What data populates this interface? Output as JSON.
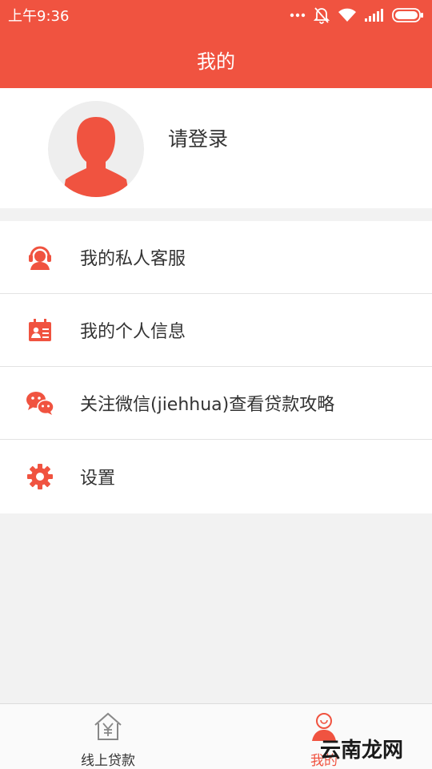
{
  "status_bar": {
    "time": "上午9:36"
  },
  "header": {
    "title": "我的"
  },
  "profile": {
    "login_prompt": "请登录"
  },
  "menu": {
    "items": [
      {
        "label": "我的私人客服",
        "icon": "headset-agent-icon"
      },
      {
        "label": "我的个人信息",
        "icon": "id-card-icon"
      },
      {
        "label": "关注微信(jiehhua)查看贷款攻略",
        "icon": "wechat-icon"
      },
      {
        "label": "设置",
        "icon": "gear-icon"
      }
    ]
  },
  "bottom_nav": {
    "tabs": [
      {
        "label": "线上贷款",
        "icon": "house-yen-icon",
        "active": false
      },
      {
        "label": "我的",
        "icon": "user-icon",
        "active": true
      }
    ]
  },
  "watermark": "云南龙网",
  "colors": {
    "accent": "#f05340",
    "text": "#333333",
    "background": "#f2f2f2"
  }
}
